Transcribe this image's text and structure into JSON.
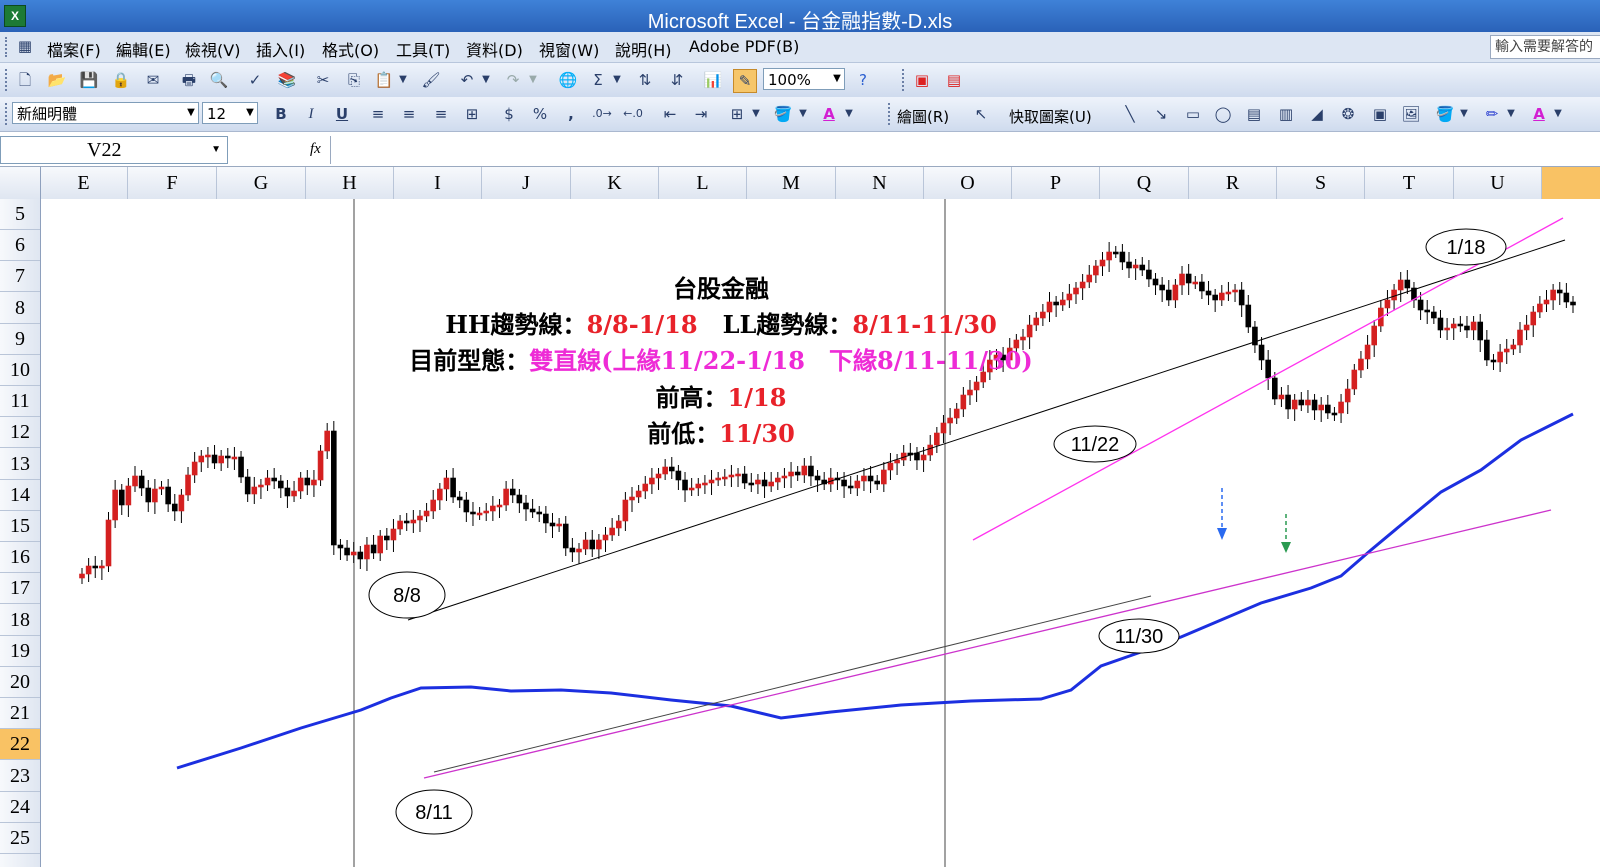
{
  "window": {
    "title": "Microsoft Excel - 台金融指數-D.xls",
    "app_icon": "X"
  },
  "menu": {
    "items": [
      "檔案(F)",
      "編輯(E)",
      "檢視(V)",
      "插入(I)",
      "格式(O)",
      "工具(T)",
      "資料(D)",
      "視窗(W)",
      "說明(H)",
      "Adobe PDF(B)"
    ],
    "help_placeholder": "輸入需要解答的"
  },
  "toolbar_standard": {
    "zoom": "100%"
  },
  "toolbar_format": {
    "font": "新細明體",
    "size": "12",
    "bold": "B",
    "italic": "I",
    "underline": "U",
    "currency": "$",
    "percent": "%",
    "comma": ","
  },
  "toolbar_drawing": {
    "draw_label": "繪圖(R)",
    "autoshape_label": "快取圖案(U)"
  },
  "formula_bar": {
    "name_box": "V22",
    "fx": "fx"
  },
  "columns": [
    "E",
    "F",
    "G",
    "H",
    "I",
    "J",
    "K",
    "L",
    "M",
    "N",
    "O",
    "P",
    "Q",
    "R",
    "S",
    "T",
    "U",
    ""
  ],
  "rows": [
    "5",
    "6",
    "7",
    "8",
    "9",
    "10",
    "11",
    "12",
    "13",
    "14",
    "15",
    "16",
    "17",
    "18",
    "19",
    "20",
    "21",
    "22",
    "23",
    "24",
    "25"
  ],
  "selected": {
    "column": "",
    "row": "22"
  },
  "annotation": {
    "title": "台股金融",
    "hh_label": "HH趨勢線：",
    "hh_value": "8/8-1/18",
    "ll_label": "LL趨勢線：",
    "ll_value": "8/11-11/30",
    "pattern_label": "目前型態：",
    "pattern_value": "雙直線(上緣11/22-1/18　下緣8/11-11/30)",
    "prev_high_label": "前高：",
    "prev_high_value": "1/18",
    "prev_low_label": "前低：",
    "prev_low_value": "11/30"
  },
  "chart_data": {
    "type": "candlestick",
    "callouts": [
      "8/8",
      "8/11",
      "11/22",
      "11/30",
      "1/18"
    ],
    "colors": {
      "up": "#d42020",
      "down": "#000000",
      "ma": "#1c2fe0",
      "hh_line": "#000000",
      "upper_line": "#ff33ee",
      "lower_line": "#cc33cc",
      "arrow_down": "#2a6af0",
      "arrow_green": "#2a9a50"
    }
  }
}
